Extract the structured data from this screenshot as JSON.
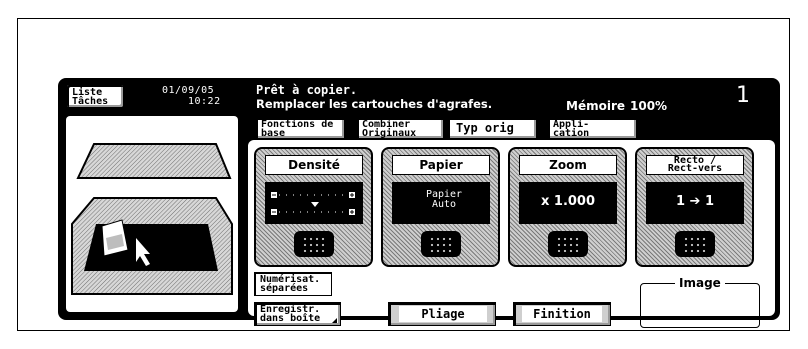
{
  "header": {
    "job_list_label": "Liste Tâches",
    "date": "01/09/05",
    "time": "10:22",
    "status_line1": "Prêt à copier.",
    "status_line2": "Remplacer les cartouches d'agrafes.",
    "memory_label": "Mémoire",
    "memory_value": "100%",
    "copy_count": "1"
  },
  "tabs": [
    {
      "label": "Fonctions de base",
      "active": true
    },
    {
      "label": "Combiner Originaux",
      "active": false
    },
    {
      "label": "Typ orig",
      "active": false
    },
    {
      "label": "Appli- cation",
      "active": false
    }
  ],
  "cards": [
    {
      "title": "Densité",
      "value": "",
      "icon": "density-slider"
    },
    {
      "title": "Papier",
      "value": "Papier Auto"
    },
    {
      "title": "Zoom",
      "value": "x 1.000"
    },
    {
      "title": "Recto / Rect-vers",
      "value": "1 ➔ 1"
    }
  ],
  "buttons": {
    "scan_separate": "Numérisat. séparées",
    "save_box": "Enregistr. dans boîte",
    "fold": "Pliage",
    "finish": "Finition"
  },
  "image_panel_label": "Image",
  "colors": {
    "screen_bg": "#000000",
    "panel_bg": "#ffffff",
    "pattern": "#7a7a7a"
  }
}
